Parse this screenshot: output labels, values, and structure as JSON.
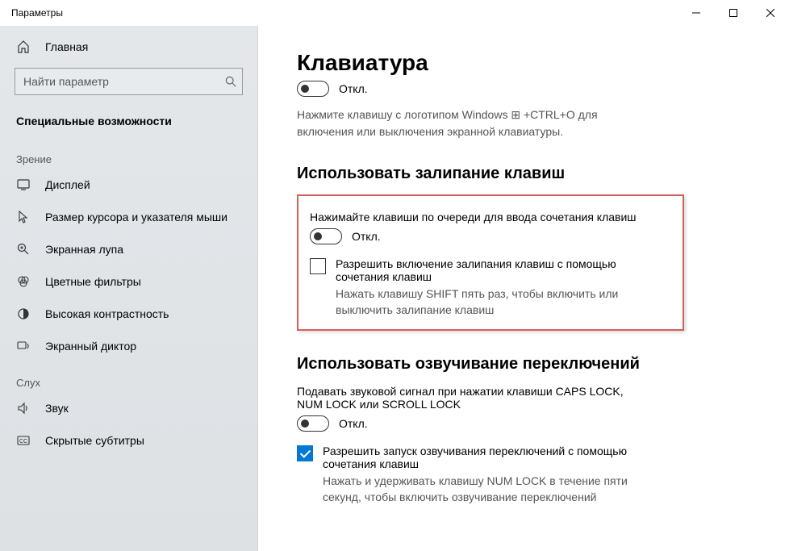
{
  "window": {
    "title": "Параметры"
  },
  "sidebar": {
    "home": "Главная",
    "searchPlaceholder": "Найти параметр",
    "sectionTitle": "Специальные возможности",
    "group1": "Зрение",
    "items1": [
      {
        "label": "Дисплей"
      },
      {
        "label": "Размер курсора и указателя мыши"
      },
      {
        "label": "Экранная лупа"
      },
      {
        "label": "Цветные фильтры"
      },
      {
        "label": "Высокая контрастность"
      },
      {
        "label": "Экранный диктор"
      }
    ],
    "group2": "Слух",
    "items2": [
      {
        "label": "Звук"
      },
      {
        "label": "Скрытые субтитры"
      }
    ]
  },
  "main": {
    "pageTitle": "Клавиатура",
    "osk": {
      "toggleState": "Откл.",
      "helper": "Нажмите клавишу с логотипом Windows ⊞ +CTRL+O для включения или выключения экранной клавиатуры."
    },
    "sticky": {
      "heading": "Использовать залипание клавиш",
      "label": "Нажимайте клавиши по очереди для ввода сочетания клавиш",
      "toggleState": "Откл.",
      "checkLabel": "Разрешить включение залипания клавиш с помощью сочетания клавиш",
      "checkSub": "Нажать клавишу SHIFT пять раз, чтобы включить или выключить залипание клавиш"
    },
    "toggleSounds": {
      "heading": "Использовать озвучивание переключений",
      "label": "Подавать звуковой сигнал при нажатии клавиши CAPS LOCK, NUM LOCK или SCROLL LOCK",
      "toggleState": "Откл.",
      "checkLabel": "Разрешить запуск озвучивания переключений с помощью сочетания клавиш",
      "checkSub": "Нажать и удерживать клавишу NUM LOCK в течение пяти секунд, чтобы включить озвучивание переключений"
    }
  }
}
